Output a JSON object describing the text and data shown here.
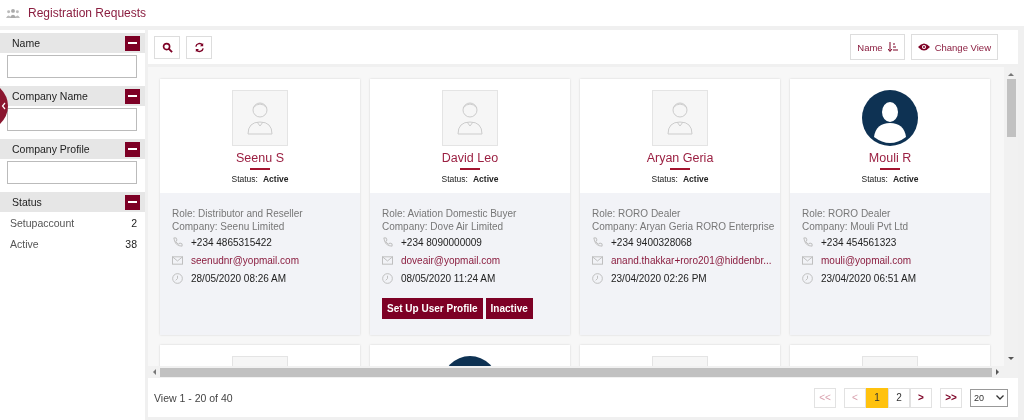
{
  "page": {
    "title": "Registration Requests"
  },
  "filters": [
    {
      "kind": "text",
      "label": "Name",
      "expanded": true
    },
    {
      "kind": "text",
      "label": "Company Name",
      "expanded": true
    },
    {
      "kind": "text",
      "label": "Company Profile",
      "expanded": true
    },
    {
      "kind": "list",
      "label": "Status",
      "expanded": true,
      "options": [
        {
          "label": "Setupaccount",
          "count": "2"
        },
        {
          "label": "Active",
          "count": "38"
        }
      ]
    }
  ],
  "toolbar": {
    "sort": {
      "label": "Name"
    },
    "view": {
      "label": "Change View"
    }
  },
  "cards": [
    {
      "avatar": {
        "kind": "placeholder"
      },
      "name": "Seenu S",
      "status_label": "Status:",
      "status": "Active",
      "role": "Role: Distributor and Reseller",
      "company": "Company: Seenu Limited",
      "phone": "+234 4865315422",
      "email": "seenudnr@yopmail.com",
      "date": "28/05/2020 08:26 AM"
    },
    {
      "avatar": {
        "kind": "placeholder"
      },
      "name": "David Leo",
      "status_label": "Status:",
      "status": "Active",
      "role": "Role: Aviation Domestic Buyer",
      "company": "Company: Dove Air Limited",
      "phone": "+234 8090000009",
      "email": "doveair@yopmail.com",
      "date": "08/05/2020 11:24 AM",
      "buttons": [
        "Set Up User Profile",
        "Inactive"
      ]
    },
    {
      "avatar": {
        "kind": "placeholder"
      },
      "name": "Aryan Geria",
      "status_label": "Status:",
      "status": "Active",
      "role": "Role: RORO Dealer",
      "company": "Company: Aryan Geria RORO Enterprise",
      "phone": "+234 9400328068",
      "email": "anand.thakkar+roro201@hiddenbr...",
      "date": "23/04/2020 02:26 PM"
    },
    {
      "avatar": {
        "kind": "silhouette"
      },
      "name": "Mouli R",
      "status_label": "Status:",
      "status": "Active",
      "role": "Role: RORO Dealer",
      "company": "Company: Mouli Pvt Ltd",
      "phone": "+234 454561323",
      "email": "mouli@yopmail.com",
      "date": "23/04/2020 06:51 AM"
    },
    {
      "avatar": {
        "kind": "placeholder"
      }
    },
    {
      "avatar": {
        "kind": "silhouette"
      }
    },
    {
      "avatar": {
        "kind": "placeholder"
      }
    },
    {
      "avatar": {
        "kind": "placeholder"
      }
    }
  ],
  "pager": {
    "summary": "View 1 - 20 of 40",
    "first": {
      "label": "<<",
      "disabled": true
    },
    "prev": {
      "label": "<",
      "disabled": true
    },
    "pages": [
      {
        "label": "1",
        "selected": true
      },
      {
        "label": "2",
        "selected": false
      }
    ],
    "next": {
      "label": ">",
      "disabled": false
    },
    "last": {
      "label": ">>",
      "disabled": false
    },
    "page_size": "20"
  }
}
